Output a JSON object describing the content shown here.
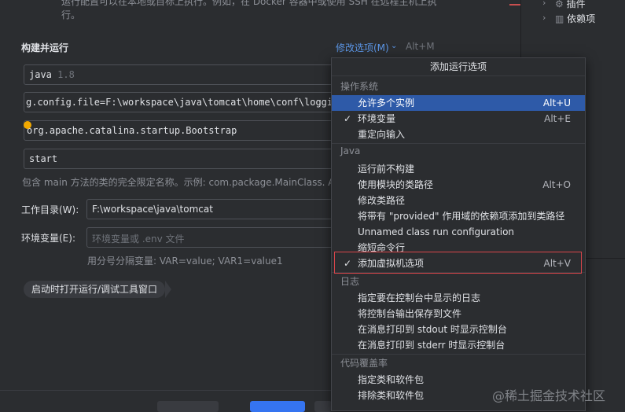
{
  "top_note": {
    "line1": "运行配置可以在本地或目标上执行。例如，在 Docker 容器中或使用 SSH 在远程主机上执",
    "line2": "行。"
  },
  "section": {
    "title": "构建并运行",
    "modify_link": "修改选项(M)",
    "modify_shortcut": "Alt+M"
  },
  "fields": {
    "jdk": {
      "value": "java",
      "sub": "1.8"
    },
    "vm_options": {
      "value": "g.config.file=F:\\workspace\\java\\tomcat\\home\\conf\\logging"
    },
    "main_class": {
      "value": "org.apache.catalina.startup.Bootstrap"
    },
    "program_args": {
      "value": "start"
    }
  },
  "main_class_hint": "包含 main 方法的类的完全限定名称。示例: com.package.MainClass. Al",
  "working_dir": {
    "label": "工作目录(W):",
    "value": "F:\\workspace\\java\\tomcat"
  },
  "env_vars": {
    "label": "环境变量(E):",
    "placeholder": "环境变量或 .env 文件",
    "hint": "用分号分隔变量: VAR=value; VAR1=value1"
  },
  "open_tool_window_pill": "启动时打开运行/调试工具窗口",
  "right_panel": {
    "items": [
      "插件",
      "依赖项"
    ]
  },
  "popup": {
    "title": "添加运行选项",
    "groups": [
      {
        "title": "操作系统",
        "items": [
          {
            "label": "允许多个实例",
            "shortcut": "Alt+U",
            "checked": false,
            "selected": true
          },
          {
            "label": "环境变量",
            "shortcut": "Alt+E",
            "checked": true,
            "selected": false
          },
          {
            "label": "重定向输入",
            "shortcut": "",
            "checked": false,
            "selected": false
          }
        ]
      },
      {
        "title": "Java",
        "items": [
          {
            "label": "运行前不构建",
            "shortcut": "",
            "checked": false,
            "selected": false
          },
          {
            "label": "使用模块的类路径",
            "shortcut": "Alt+O",
            "checked": false,
            "selected": false
          },
          {
            "label": "修改类路径",
            "shortcut": "",
            "checked": false,
            "selected": false
          },
          {
            "label": "将带有 \"provided\" 作用域的依赖项添加到类路径",
            "shortcut": "",
            "checked": false,
            "selected": false
          },
          {
            "label": "Unnamed class run configuration",
            "shortcut": "",
            "checked": false,
            "selected": false
          },
          {
            "label": "缩短命令行",
            "shortcut": "",
            "checked": false,
            "selected": false
          },
          {
            "label": "添加虚拟机选项",
            "shortcut": "Alt+V",
            "checked": true,
            "selected": false
          }
        ]
      },
      {
        "title": "日志",
        "items": [
          {
            "label": "指定要在控制台中显示的日志",
            "shortcut": "",
            "checked": false,
            "selected": false
          },
          {
            "label": "将控制台输出保存到文件",
            "shortcut": "",
            "checked": false,
            "selected": false
          },
          {
            "label": "在消息打印到 stdout 时显示控制台",
            "shortcut": "",
            "checked": false,
            "selected": false
          },
          {
            "label": "在消息打印到 stderr 时显示控制台",
            "shortcut": "",
            "checked": false,
            "selected": false
          }
        ]
      },
      {
        "title": "代码覆盖率",
        "items": [
          {
            "label": "指定类和软件包",
            "shortcut": "",
            "checked": false,
            "selected": false
          },
          {
            "label": "排除类和软件包",
            "shortcut": "",
            "checked": false,
            "selected": false
          }
        ]
      }
    ]
  },
  "watermark": "@稀土掘金技术社区"
}
